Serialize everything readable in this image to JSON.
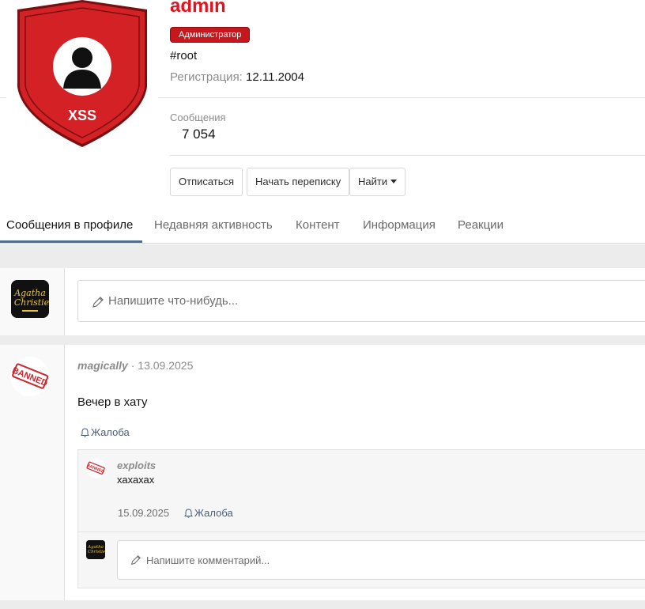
{
  "profile": {
    "username": "admin",
    "role": "Администратор",
    "tagline": "#root",
    "registration_label": "Регистрация:",
    "registration_date": "12.11.2004",
    "avatar_text": "XSS",
    "messages_label": "Сообщения",
    "messages_count": "7 054"
  },
  "actions": {
    "unsubscribe": "Отписаться",
    "start_conversation": "Начать переписку",
    "find": "Найти"
  },
  "tabs": [
    {
      "label": "Сообщения в профиле",
      "active": true
    },
    {
      "label": "Недавняя активность",
      "active": false
    },
    {
      "label": "Контент",
      "active": false
    },
    {
      "label": "Информация",
      "active": false
    },
    {
      "label": "Реакции",
      "active": false
    }
  ],
  "composer": {
    "placeholder": "Напишите что-нибудь..."
  },
  "post": {
    "author": "magically",
    "separator": "·",
    "date": "13.09.2025",
    "body": "Вечер в хату",
    "report_label": "Жалоба",
    "banned_stamp": "BANNED"
  },
  "comment": {
    "author": "exploits",
    "text": "хахахах",
    "date": "15.09.2025",
    "report_label": "Жалоба",
    "banned_stamp": "BANNED",
    "reply_placeholder": "Напишите комментарий..."
  },
  "mini_avatar_text": [
    "Agatha",
    "Christie"
  ],
  "colors": {
    "username": "#e0141e",
    "role_badge": "#c6171d",
    "shield": "#d42126",
    "active_tab_underline": "#4f6f91",
    "banned_stamp": "#c8282e"
  }
}
